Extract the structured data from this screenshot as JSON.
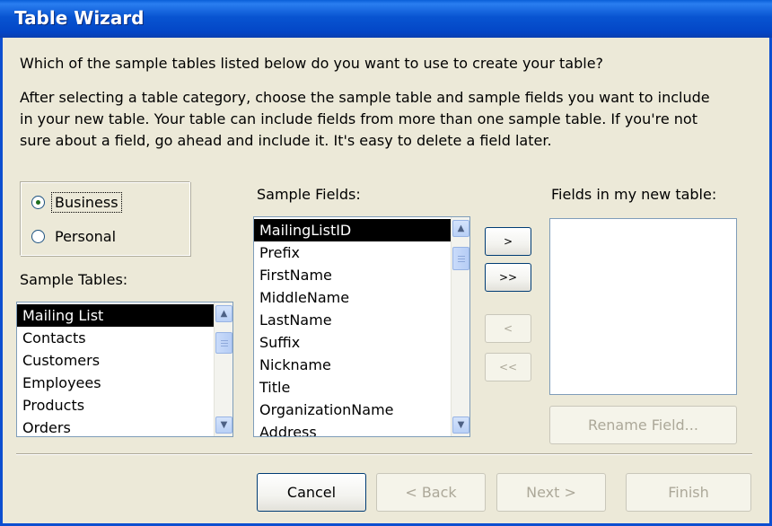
{
  "window": {
    "title": "Table Wizard"
  },
  "prompt": "Which of the sample tables listed below do you want to use to create your table?",
  "description": [
    "After selecting a table category, choose the sample table and sample fields you want to include",
    "in your new table. Your table can include fields from more than one sample table. If you're not",
    "sure about a field, go ahead and include it. It's easy to delete a field later."
  ],
  "category": {
    "options": [
      "Business",
      "Personal"
    ],
    "selected": "Business"
  },
  "sample_tables": {
    "label": "Sample Tables:",
    "items": [
      "Mailing List",
      "Contacts",
      "Customers",
      "Employees",
      "Products",
      "Orders"
    ],
    "selected": "Mailing List"
  },
  "sample_fields": {
    "label": "Sample Fields:",
    "items": [
      "MailingListID",
      "Prefix",
      "FirstName",
      "MiddleName",
      "LastName",
      "Suffix",
      "Nickname",
      "Title",
      "OrganizationName",
      "Address"
    ],
    "selected": "MailingListID"
  },
  "new_table_fields": {
    "label": "Fields in my new table:",
    "items": []
  },
  "move_buttons": {
    "add_one": ">",
    "add_all": ">>",
    "remove_one": "<",
    "remove_all": "<<"
  },
  "rename_button": "Rename Field...",
  "footer": {
    "cancel": "Cancel",
    "back": "< Back",
    "next": "Next >",
    "finish": "Finish"
  }
}
